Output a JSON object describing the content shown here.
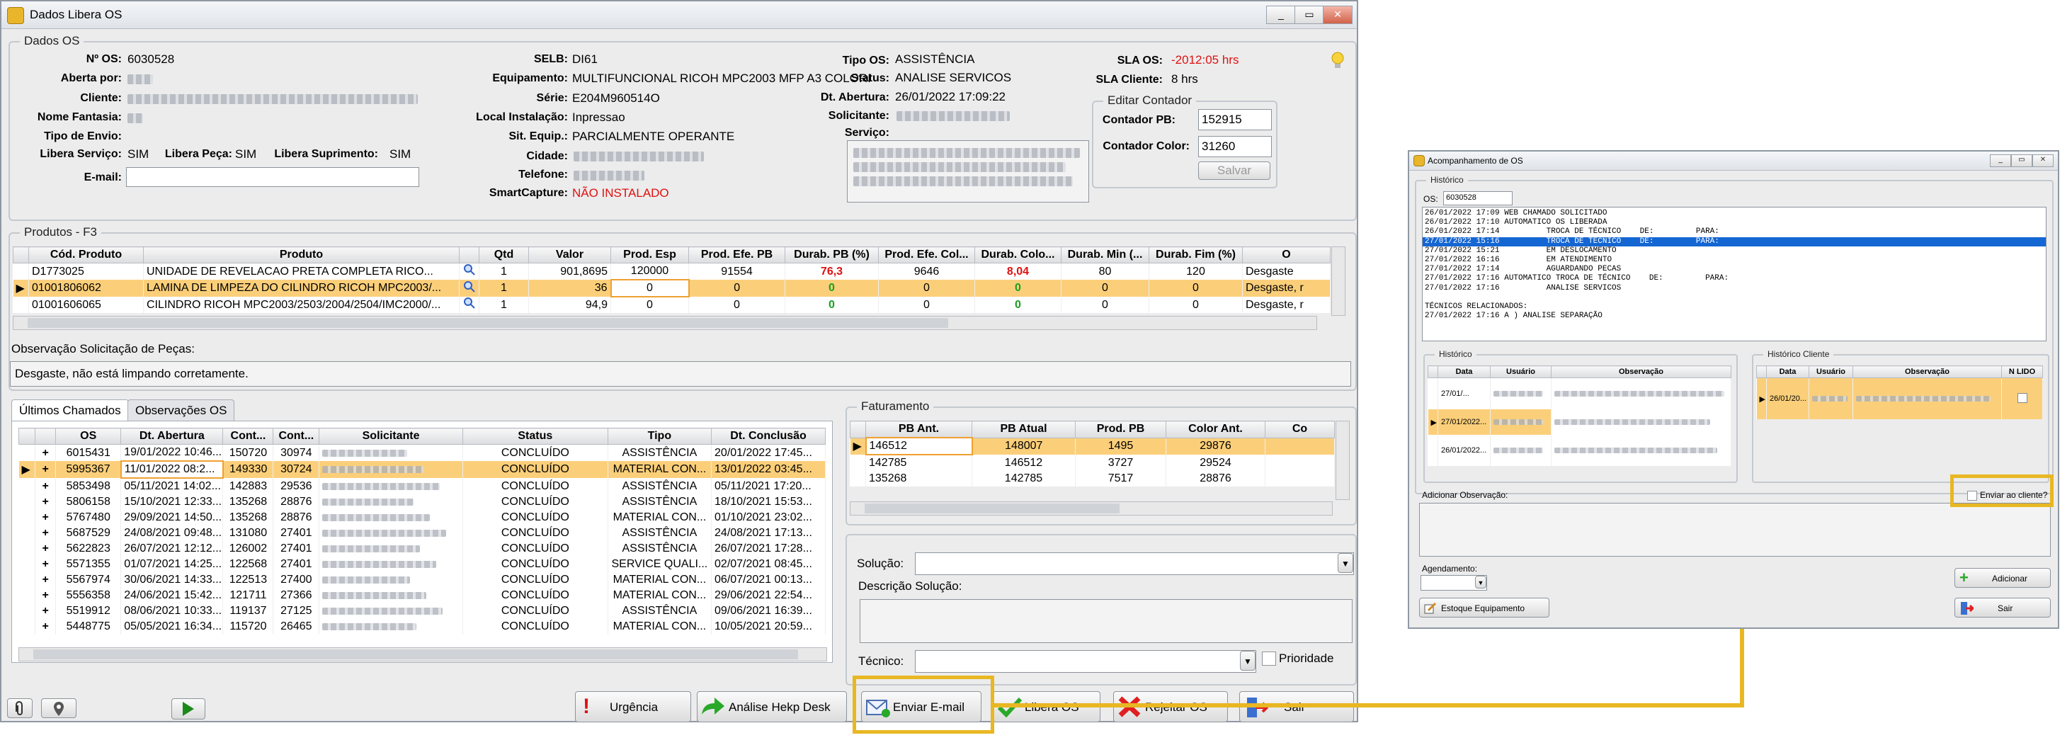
{
  "main_window": {
    "title": "Dados Libera OS",
    "controls": {
      "minimize": "_",
      "maximize": "▭",
      "close": "✕"
    },
    "dados_os": {
      "legend": "Dados OS",
      "labels": {
        "num_os": "Nº OS:",
        "aberta_por": "Aberta por:",
        "cliente": "Cliente:",
        "nome_fantasia": "Nome Fantasia:",
        "tipo_envio": "Tipo de Envio:",
        "libera_servico": "Libera Serviço:",
        "libera_peca": "Libera Peça:",
        "libera_suprimento": "Libera Suprimento:",
        "email": "E-mail:",
        "selb": "SELB:",
        "equipamento": "Equipamento:",
        "serie": "Série:",
        "local_instalacao": "Local Instalação:",
        "sit_equip": "Sit. Equip.:",
        "cidade": "Cidade:",
        "telefone": "Telefone:",
        "smartcapture": "SmartCapture:",
        "tipo_os": "Tipo OS:",
        "status": "Status:",
        "dt_abertura": "Dt. Abertura:",
        "solicitante": "Solicitante:",
        "servico": "Serviço:",
        "sla_os": "SLA OS:",
        "sla_cliente": "SLA Cliente:"
      },
      "values": {
        "num_os": "6030528",
        "libera_servico": "SIM",
        "libera_peca": "SIM",
        "libera_suprimento": "SIM",
        "selb": "DI61",
        "equipamento": "MULTIFUNCIONAL RICOH MPC2003 MFP A3 COLORI",
        "serie": "E204M960514O",
        "local_instalacao": "Inpressao",
        "sit_equip": "PARCIALMENTE OPERANTE",
        "smartcapture": "NÃO INSTALADO",
        "tipo_os": "ASSISTÊNCIA",
        "status": "ANALISE SERVICOS",
        "dt_abertura": "26/01/2022 17:09:22",
        "sla_os": "-2012:05 hrs",
        "sla_cliente": "8 hrs"
      },
      "editar_contador": {
        "legend": "Editar Contador",
        "pb_label": "Contador PB:",
        "pb_value": "152915",
        "color_label": "Contador Color:",
        "color_value": "31260",
        "salvar": "Salvar"
      }
    },
    "produtos": {
      "legend": "Produtos - F3",
      "columns": [
        "Cód. Produto",
        "Produto",
        "",
        "Qtd",
        "Valor",
        "Prod. Esp",
        "Prod. Efe. PB",
        "Durab. PB (%)",
        "Prod. Efe. Col...",
        "Durab. Colo...",
        "Durab. Min (...",
        "Durab. Fim (%)",
        "O"
      ],
      "rows": [
        [
          "D1773025",
          "UNIDADE DE REVELACAO PRETA COMPLETA RICO...",
          "1",
          "901,8695",
          "120000",
          "91554",
          "76,3",
          "9646",
          "8,04",
          "80",
          "120",
          "Desgaste"
        ],
        [
          "01001806062",
          "LAMINA DE LIMPEZA DO CILINDRO RICOH MPC2003/...",
          "1",
          "36",
          "0",
          "0",
          "0",
          "0",
          "0",
          "0",
          "0",
          "Desgaste, r"
        ],
        [
          "01001606065",
          "CILINDRO RICOH MPC2003/2503/2004/2504/IMC2000/...",
          "1",
          "94,9",
          "0",
          "0",
          "0",
          "0",
          "0",
          "0",
          "0",
          "Desgaste, r"
        ]
      ],
      "obs_label": "Observação Solicitação de Peças:",
      "obs_value": "Desgaste, não está limpando corretamente."
    },
    "tabs": [
      "Últimos Chamados",
      "Observações OS"
    ],
    "chamados": {
      "columns": [
        "",
        "OS",
        "Dt. Abertura",
        "Cont...",
        "Cont...",
        "Solicitante",
        "Status",
        "Tipo",
        "Dt. Conclusão"
      ],
      "rows": [
        [
          "6015431",
          "19/01/2022 10:46...",
          "150720",
          "30974",
          "CONCLUÍDO",
          "ASSISTÊNCIA",
          "20/01/2022 17:45..."
        ],
        [
          "5995367",
          "11/01/2022 08:2...",
          "149330",
          "30724",
          "CONCLUÍDO",
          "MATERIAL CON...",
          "13/01/2022 03:45..."
        ],
        [
          "5853498",
          "05/11/2021 14:02...",
          "142883",
          "29536",
          "CONCLUÍDO",
          "ASSISTÊNCIA",
          "05/11/2021 17:20..."
        ],
        [
          "5806158",
          "15/10/2021 12:33...",
          "135268",
          "28876",
          "CONCLUÍDO",
          "ASSISTÊNCIA",
          "18/10/2021 15:53..."
        ],
        [
          "5767480",
          "29/09/2021 14:50...",
          "135268",
          "28876",
          "CONCLUÍDO",
          "MATERIAL CON...",
          "01/10/2021 23:02..."
        ],
        [
          "5687529",
          "24/08/2021 09:48...",
          "131080",
          "27401",
          "CONCLUÍDO",
          "ASSISTÊNCIA",
          "24/08/2021 17:13..."
        ],
        [
          "5622823",
          "26/07/2021 12:12...",
          "126002",
          "27401",
          "CONCLUÍDO",
          "ASSISTÊNCIA",
          "26/07/2021 17:28..."
        ],
        [
          "5571355",
          "01/07/2021 14:25...",
          "122568",
          "27401",
          "CONCLUÍDO",
          "SERVICE QUALI...",
          "02/07/2021 08:45..."
        ],
        [
          "5567974",
          "30/06/2021 14:33...",
          "122513",
          "27400",
          "CONCLUÍDO",
          "MATERIAL CON...",
          "06/07/2021 00:13..."
        ],
        [
          "5556358",
          "24/06/2021 15:42...",
          "121711",
          "27366",
          "CONCLUÍDO",
          "MATERIAL CON...",
          "29/06/2021 22:54..."
        ],
        [
          "5519912",
          "08/06/2021 10:33...",
          "119137",
          "27125",
          "CONCLUÍDO",
          "ASSISTÊNCIA",
          "09/06/2021 16:39..."
        ],
        [
          "5448775",
          "05/05/2021 16:34...",
          "115720",
          "26465",
          "CONCLUÍDO",
          "MATERIAL CON...",
          "10/05/2021 20:59..."
        ]
      ]
    },
    "faturamento": {
      "legend": "Faturamento",
      "columns": [
        "",
        "PB Ant.",
        "PB Atual",
        "Prod. PB",
        "Color Ant.",
        "Co"
      ],
      "rows": [
        [
          "146512",
          "148007",
          "1495",
          "29876"
        ],
        [
          "142785",
          "146512",
          "3727",
          "29524"
        ],
        [
          "135268",
          "142785",
          "7517",
          "28876"
        ]
      ]
    },
    "solucao": {
      "solucao_label": "Solução:",
      "descricao_label": "Descrição Solução:",
      "tecnico_label": "Técnico:",
      "prioridade_label": "Prioridade"
    },
    "buttons": {
      "urgencia": "Urgência",
      "analise": "Análise Hekp Desk",
      "enviar_email": "Enviar E-mail",
      "libera_os": "Libera OS",
      "rejeitar_os": "Rejeitar OS",
      "sair": "Sair"
    }
  },
  "acomp_window": {
    "title": "Acompanhamento de OS",
    "historico_legend": "Histórico",
    "os_label": "OS:",
    "os_value": "6030528",
    "log_lines": [
      "26/01/2022 17:09 WEB CHAMADO SOLICITADO",
      "26/01/2022 17:10 AUTOMATICO OS LIBERADA",
      "26/01/2022 17:14          TROCA DE TÉCNICO    DE:         PARA:",
      "27/01/2022 15:16          TROCA DE TECNICO    DE:         PARA:",
      "27/01/2022 15:21          EM DESLOCAMENTO",
      "27/01/2022 16:16          EM ATENDIMENTO",
      "27/01/2022 17:14          AGUARDANDO PECAS",
      "27/01/2022 17:16 AUTOMATICO TROCA DE TÉCNICO    DE:         PARA:",
      "27/01/2022 17:16          ANALISE SERVICOS",
      "",
      "TÉCNICOS RELACIONADOS:",
      "27/01/2022 17:16 A ) ANALISE SEPARAÇÃO"
    ],
    "hist_legend": "Histórico",
    "hist_columns": [
      "",
      "Data",
      "Usuário",
      "Observação"
    ],
    "hist_rows": [
      "27/01/...",
      "27/01/2022...",
      "26/01/2022..."
    ],
    "hist_cliente_legend": "Histórico Cliente",
    "hist_cliente_columns": [
      "",
      "Data",
      "Usuário",
      "Observação",
      "N LIDO"
    ],
    "hist_cliente_rows": [
      "26/01/20..."
    ],
    "add_obs_label": "Adicionar Observação:",
    "enviar_cliente_label": "Enviar ao cliente?",
    "agendamento_label": "Agendamento:",
    "adicionar": "Adicionar",
    "estoque": "Estoque Equipamento",
    "sair": "Sair"
  }
}
